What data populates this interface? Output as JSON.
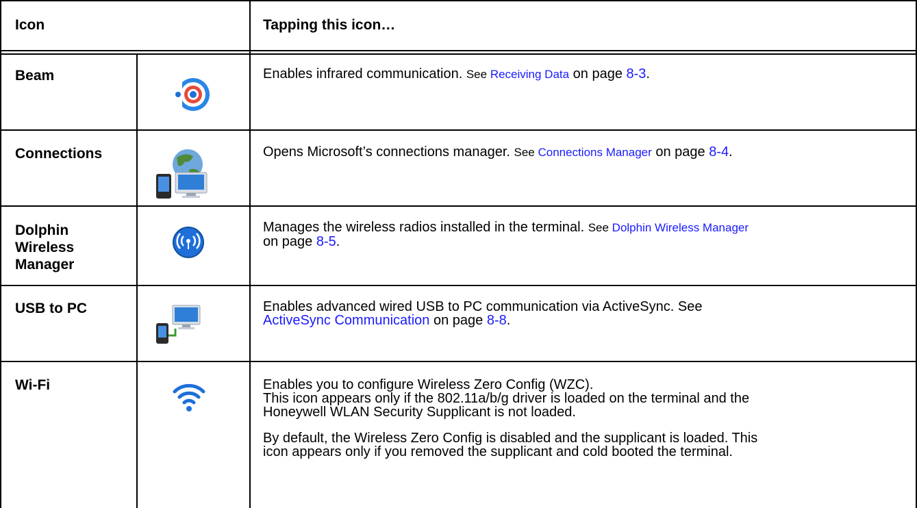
{
  "header": {
    "col1": "Icon",
    "col2": "Tapping this icon…"
  },
  "rows": [
    {
      "name": "Beam",
      "icon": "beam-icon",
      "desc": {
        "pre": "Enables infrared communication. ",
        "see": "See ",
        "link1": "Receiving Data",
        "mid": " on page ",
        "link2": "8-3",
        "post": "."
      }
    },
    {
      "name": "Connections",
      "icon": "connections-icon",
      "desc": {
        "pre": "Opens Microsoft’s connections manager. ",
        "see": "See ",
        "link1": "Connections Manager",
        "mid": " on page ",
        "link2": "8-4",
        "post": "."
      }
    },
    {
      "name_lines": [
        "Dolphin",
        "Wireless",
        "Manager"
      ],
      "icon": "wireless-manager-icon",
      "desc": {
        "pre": "Manages the wireless radios installed in the terminal. ",
        "see": "See ",
        "link1": "Dolphin Wireless Manager",
        "mid": "on page ",
        "link2": "8-5",
        "post": "."
      }
    },
    {
      "name": "USB to PC",
      "icon": "usb-to-pc-icon",
      "desc": {
        "pre": "Enables advanced wired USB to PC communication via ActiveSync. See",
        "link1": "ActiveSync Communication",
        "mid": " on page ",
        "link2": "8-8",
        "post": "."
      }
    },
    {
      "name": "Wi-Fi",
      "icon": "wifi-icon",
      "desc": {
        "line1": "Enables you to configure Wireless Zero Config (WZC).",
        "line2": "This icon appears only if the 802.11a/b/g driver is loaded on the terminal and the",
        "line3": "Honeywell WLAN Security Supplicant is not loaded.",
        "line4": "By default, the Wireless Zero Config is disabled and the supplicant is loaded. This",
        "line5": "icon appears only if you removed the supplicant and cold booted the terminal."
      }
    }
  ],
  "colors": {
    "link": "#1a1aff",
    "icon_blue": "#1e6fd9",
    "beam_red": "#e8493b"
  }
}
